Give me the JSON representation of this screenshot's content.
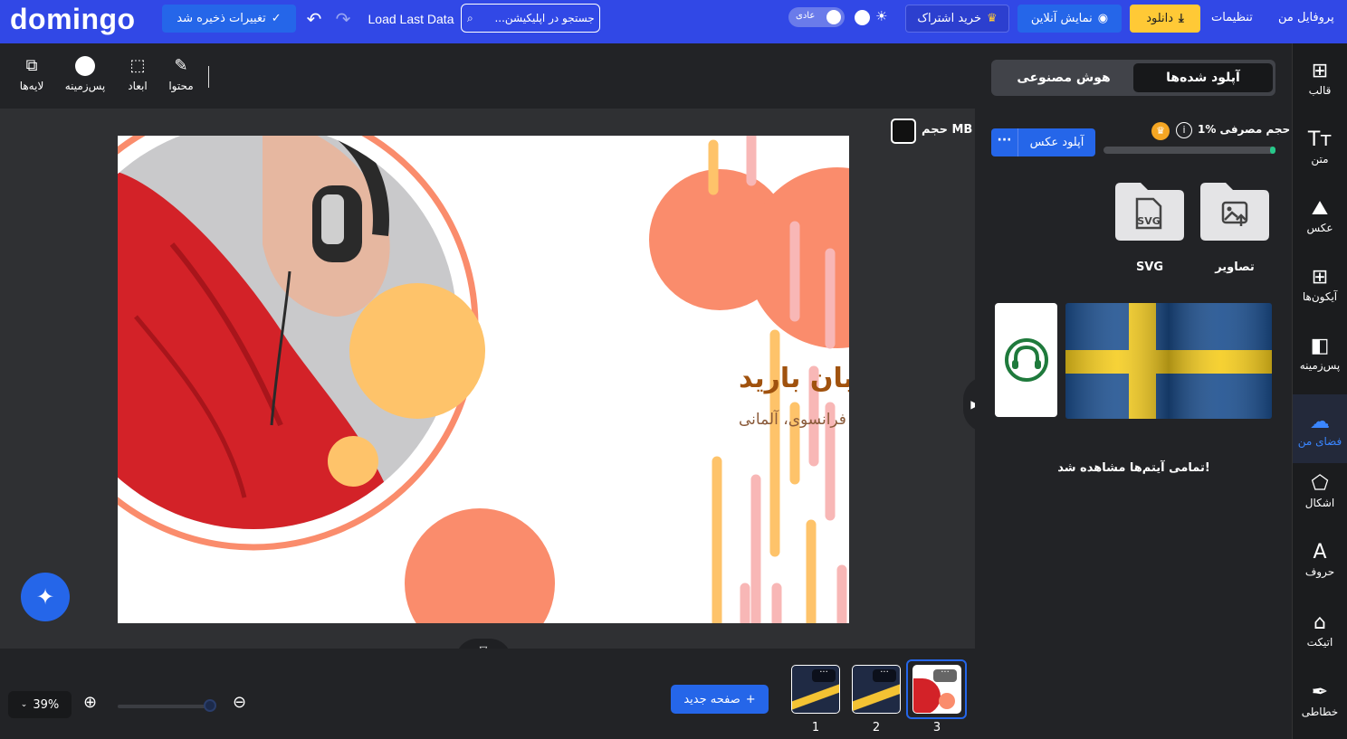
{
  "header": {
    "logo": "domingo",
    "save_status": "تغییرات ذخیره شد",
    "load_last_data": "Load Last Data",
    "search_placeholder": "جستجو در اپلیکیشن...",
    "mode_label": "عادی",
    "subscribe": "خرید اشتراک",
    "live_preview": "نمایش آنلاین",
    "download": "دانلود",
    "settings": "تنظیمات",
    "profile": "پروفایل من"
  },
  "toolbar": {
    "layers": "لایه‌ها",
    "background": "پس‌زمینه",
    "dimensions": "ابعاد",
    "content": "محتوا"
  },
  "canvas": {
    "size_label": "حجم MB",
    "design_title": "موسسه زبان بارید",
    "design_subtitle": "انگلیسی، فرانسوی، آلمانی",
    "colors": {
      "orange": "#fa8c6c",
      "yellow": "#fec36a",
      "pink": "#f8b7b6",
      "title": "#a0520e",
      "subtitle": "#8a5a3a"
    }
  },
  "bottom": {
    "zoom": "39%",
    "zoom_level": 0.95,
    "new_page": "صفحه جدید",
    "pages": [
      {
        "number": "1",
        "more": "···"
      },
      {
        "number": "2",
        "more": "···"
      },
      {
        "number": "3",
        "more": "···"
      }
    ],
    "active_page": "3"
  },
  "panel": {
    "tab_uploads": "آپلود شده‌ها",
    "tab_ai": "هوش مصنوعی",
    "usage_label": "حجم مصرفی %1",
    "usage_percent": 1,
    "upload_button": "آپلود عکس",
    "upload_more": "···",
    "folders": [
      {
        "label": "تصاویر",
        "icon": "image-folder-icon"
      },
      {
        "label": "SVG",
        "icon": "svg-folder-icon",
        "badge": "SVG"
      }
    ],
    "all_seen": "تمامی آیتم‌ها مشاهده شد!"
  },
  "sidebar": {
    "items": [
      {
        "label": "قالب",
        "icon": "template-icon"
      },
      {
        "label": "متن",
        "icon": "text-icon"
      },
      {
        "label": "عکس",
        "icon": "photo-icon"
      },
      {
        "label": "آیکون‌ها",
        "icon": "icons-grid-icon"
      },
      {
        "label": "پس‌زمینه",
        "icon": "background-icon"
      },
      {
        "label": "فضای من",
        "icon": "cloud-upload-icon"
      },
      {
        "label": "اشکال",
        "icon": "shapes-icon"
      },
      {
        "label": "حروف",
        "icon": "font-icon"
      },
      {
        "label": "اتیکت",
        "icon": "tag-icon"
      },
      {
        "label": "خطاطی",
        "icon": "calligraphy-icon"
      }
    ],
    "active": "فضای من"
  },
  "colors": {
    "accent": "#2566e9",
    "header": "#3148e6",
    "download": "#ffc936",
    "usage": "#27c88a"
  }
}
